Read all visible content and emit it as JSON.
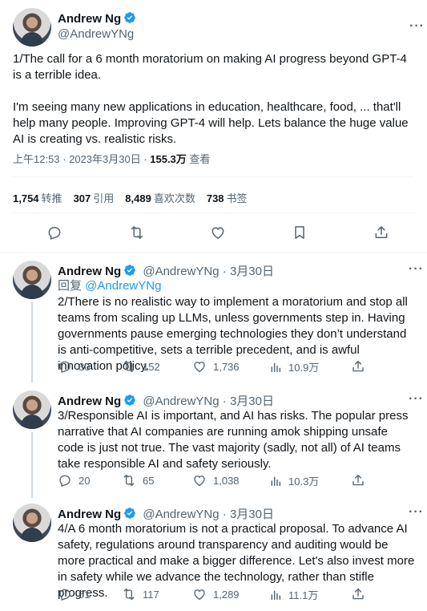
{
  "main": {
    "name": "Andrew Ng",
    "handle": "@AndrewYNg",
    "text": "1/The call for a 6 month moratorium on making AI progress beyond GPT-4 is a terrible idea.\n\nI'm seeing many new applications in education, healthcare, food, ... that'll help many people. Improving GPT-4 will help. Lets balance the huge value AI is creating vs. realistic risks.",
    "time": "上午12:53 · 2023年3月30日 · ",
    "views_count": "155.3万",
    "views_label": " 查看",
    "stats": {
      "retweets": "1,754",
      "retweets_label": "转推",
      "quotes": "307",
      "quotes_label": "引用",
      "likes": "8,489",
      "likes_label": "喜欢次数",
      "bookmarks": "738",
      "bookmarks_label": "书签"
    }
  },
  "replies": [
    {
      "name": "Andrew Ng",
      "handle": "@AndrewYNg · 3月30日",
      "reply_prefix": "回复 ",
      "reply_to": "@AndrewYNg",
      "text": "2/There is no realistic way to implement a moratorium and stop all teams from scaling up LLMs, unless governments step in. Having governments pause emerging technologies they don’t understand is anti-competitive, sets a terrible precedent, and is awful innovation policy.",
      "replies": "30",
      "retweets": "152",
      "likes": "1,736",
      "views": "10.9万"
    },
    {
      "name": "Andrew Ng",
      "handle": "@AndrewYNg · 3月30日",
      "text": "3/Responsible AI is important, and AI has risks. The popular press narrative that AI companies are running amok shipping unsafe code is just not true. The vast majority (sadly, not all) of AI teams take responsible AI and safety seriously.",
      "replies": "20",
      "retweets": "65",
      "likes": "1,038",
      "views": "10.3万"
    },
    {
      "name": "Andrew Ng",
      "handle": "@AndrewYNg · 3月30日",
      "text": "4/A 6 month moratorium is not a practical proposal. To advance AI safety, regulations around transparency and auditing would be more practical and make a bigger difference. Let's also invest more in safety while we advance the technology, rather than stifle progress.",
      "replies": "51",
      "retweets": "117",
      "likes": "1,289",
      "views": "11.1万"
    }
  ],
  "colors": {
    "accent": "#1d9bf0",
    "muted": "#536471",
    "text": "#0f1419",
    "border": "#eff3f4"
  },
  "icons": [
    "verified-badge-icon",
    "more-icon",
    "reply-icon",
    "retweet-icon",
    "like-icon",
    "bookmark-icon",
    "share-icon",
    "views-icon"
  ]
}
